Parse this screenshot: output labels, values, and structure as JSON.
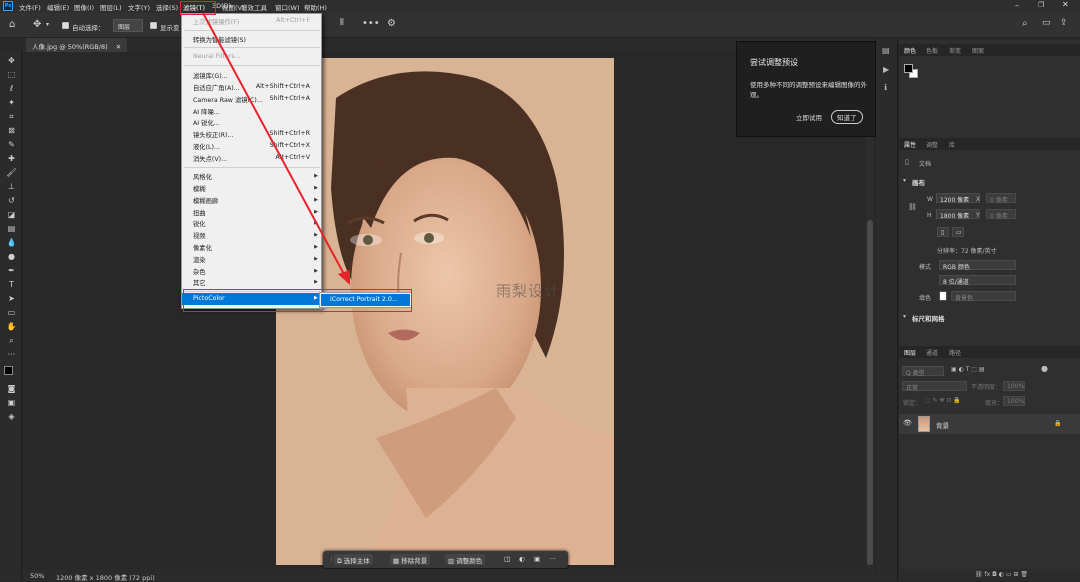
{
  "menubar": {
    "logo": "Ps",
    "items": [
      "文件(F)",
      "编辑(E)",
      "图像(I)",
      "图层(L)",
      "文字(Y)",
      "选择(S)",
      "滤镜(T)",
      "3D(D)",
      "视图(V)",
      "增效工具",
      "窗口(W)",
      "帮助(H)"
    ]
  },
  "options": {
    "auto_select_label": "自动选择：",
    "auto_select_value": "图层",
    "show_transform": "显示变"
  },
  "document": {
    "tab_title": "人像.jpg @ 50%(RGB/8)",
    "zoom": "50%",
    "dims": "1200 像素 x 1800 像素 (72 ppi)"
  },
  "filter_menu": {
    "last_filter": {
      "label": "上次滤镜操作(F)",
      "shortcut": "Alt+Ctrl+F"
    },
    "convert_smart": "转换为智能滤镜(S)",
    "neural": "Neural Filters...",
    "group1": [
      {
        "label": "滤镜库(G)...",
        "shortcut": ""
      },
      {
        "label": "自适应广角(A)...",
        "shortcut": "Alt+Shift+Ctrl+A"
      },
      {
        "label": "Camera Raw 滤镜(C)...",
        "shortcut": "Shift+Ctrl+A"
      },
      {
        "label": "AI 降噪...",
        "shortcut": ""
      },
      {
        "label": "AI 锐化...",
        "shortcut": ""
      },
      {
        "label": "镜头校正(R)...",
        "shortcut": "Shift+Ctrl+R"
      },
      {
        "label": "液化(L)...",
        "shortcut": "Shift+Ctrl+X"
      },
      {
        "label": "消失点(V)...",
        "shortcut": "Alt+Ctrl+V"
      }
    ],
    "group2": [
      "风格化",
      "模糊",
      "模糊画廊",
      "扭曲",
      "锐化",
      "视频",
      "像素化",
      "渲染",
      "杂色",
      "其它"
    ],
    "pictocolor": "PictoColor",
    "submenu_item": "iCorrect Portrait 2.0..."
  },
  "context_bar": {
    "select_subject": "选择主体",
    "remove_bg": "移除背景",
    "adjust_color": "调整颜色",
    "more": "···"
  },
  "watermark": "雨梨设计",
  "tooltip": {
    "title": "尝试调整预设",
    "body": "使用多种不同的调整预设来编辑图像的外观。",
    "try_now": "立即试用",
    "got_it": "知道了"
  },
  "color_panel": {
    "tabs": [
      "颜色",
      "色板",
      "渐变",
      "图案"
    ]
  },
  "properties_panel": {
    "tabs": [
      "属性",
      "调整",
      "库"
    ],
    "doc_label": "文档",
    "canvas_head": "画布",
    "w_label": "W",
    "w_value": "1200 像素",
    "h_label": "H",
    "h_value": "1800 像素",
    "x_label": "X",
    "y_label": "Y",
    "x_placeholder": "0 像素",
    "y_placeholder": "0 像素",
    "resolution": "分辨率：72 像素/英寸",
    "mode_label": "模式",
    "mode_value": "RGB 颜色",
    "depth_value": "8 位/通道",
    "fill_label": "填色",
    "fill_value": "背景色",
    "rulers_head": "标尺和网格"
  },
  "layers_panel": {
    "tabs": [
      "图层",
      "通道",
      "路径"
    ],
    "kind_placeholder": "Q 类型",
    "blend_mode": "正常",
    "opacity_label": "不透明度：",
    "opacity_value": "100%",
    "lock_label": "锁定：",
    "fill_label": "填充：",
    "fill_value": "100%",
    "layer_name": "背景"
  },
  "colors": {
    "accent_highlight": "#0078d7",
    "annotation_red": "#e8222a",
    "app_bg": "#282828"
  }
}
